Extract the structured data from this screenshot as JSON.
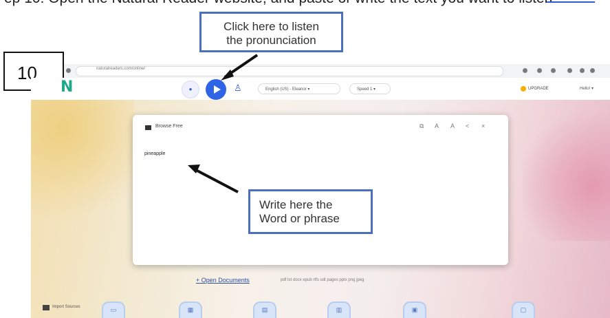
{
  "instruction": {
    "text": "ep 10: Open the Natural Reader website, and paste or write the text you want to listen",
    "link_text": "Click"
  },
  "step_number": "10",
  "callouts": {
    "listen": [
      "Click here to listen",
      "the pronunciation"
    ],
    "write": [
      "Write here the",
      "Word or phrase"
    ]
  },
  "browser": {
    "url": "naturalreaders.com/online/"
  },
  "toolbar": {
    "logo": "N",
    "minus_icon": "minus",
    "play_icon": "play",
    "person_icon": "person",
    "voice": "English (US) - Eleanor ▾",
    "speed": "Speed 1 ▾",
    "upgrade": "UPGRADE",
    "user": "Hello! ▾"
  },
  "editor": {
    "title": "Browse Free",
    "content": "pineapple",
    "header_icons": [
      "copy",
      "font-decrease",
      "font-increase",
      "share",
      "close"
    ]
  },
  "open_documents": {
    "label": "+ Open Documents",
    "file_types": "pdf txt docx epub rtfs odt pages pptx png jpeg"
  },
  "bottom_row": {
    "label": "Import Sources"
  },
  "colors": {
    "accent": "#2f64e6",
    "callout_border": "#4a6fbf",
    "logo": "#1ea88a"
  }
}
